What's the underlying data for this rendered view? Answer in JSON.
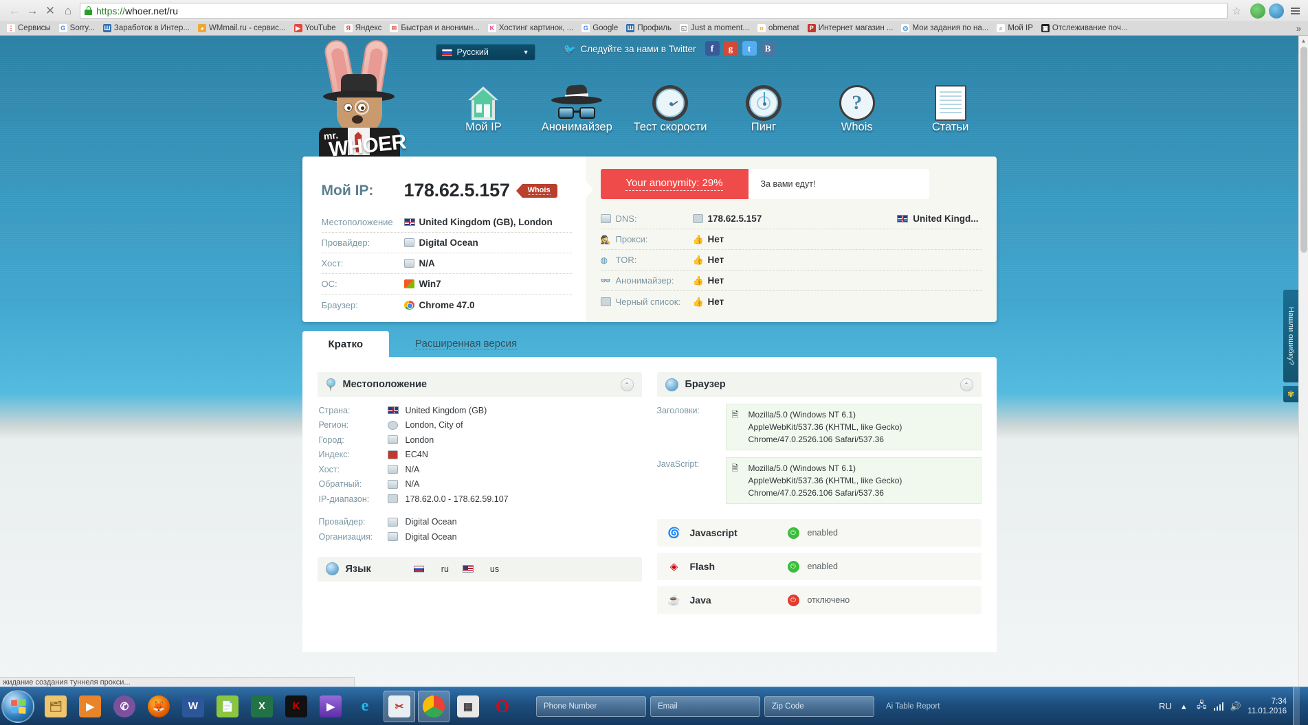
{
  "browser": {
    "back_icon": "back-arrow-icon",
    "forward_icon": "forward-arrow-icon",
    "stop_icon": "✕",
    "home_icon": "⌂",
    "url_scheme": "https://",
    "url_rest": "whoer.net/ru",
    "url_full": "https://whoer.net/ru",
    "star_icon": "☆",
    "bookmarks": [
      {
        "label": "Сервисы",
        "badge": "⋮",
        "color": "#e8453c"
      },
      {
        "label": "Sorry...",
        "badge": "G",
        "color": "#ffffff"
      },
      {
        "label": "Заработок в Интер...",
        "badge": "Ш",
        "color": "#2f6fb0"
      },
      {
        "label": "WMmail.ru - сервис...",
        "badge": "◕",
        "color": "#f0a830"
      },
      {
        "label": "YouTube",
        "badge": "▶",
        "color": "#e8453c"
      },
      {
        "label": "Яндекс",
        "badge": "Я",
        "color": "#e8453c"
      },
      {
        "label": "Быстрая и анонимн...",
        "badge": "✉",
        "color": "#d9534f"
      },
      {
        "label": "Хостинг картинок, ...",
        "badge": "K",
        "color": "#d93fa0"
      },
      {
        "label": "Google",
        "badge": "G",
        "color": "#4285f4"
      },
      {
        "label": "Профиль",
        "badge": "Ш",
        "color": "#2f6fb0"
      },
      {
        "label": "Just a moment...",
        "badge": "◱",
        "color": "#9aa0a6"
      },
      {
        "label": "obmenat",
        "badge": "о",
        "color": "#f0a830"
      },
      {
        "label": "Интернет магазин ...",
        "badge": "Р",
        "color": "#c0392b"
      },
      {
        "label": "Мои задания по на...",
        "badge": "◎",
        "color": "#4a90c2"
      },
      {
        "label": "Мой IP",
        "badge": "⌕",
        "color": "#9aa0a6"
      },
      {
        "label": "Отслеживание поч...",
        "badge": "▣",
        "color": "#222222"
      }
    ],
    "overflow_icon": "»"
  },
  "site": {
    "logo_mr": "mr.",
    "logo_name": "WHOER",
    "language": {
      "value": "Русский",
      "caret": "▼"
    },
    "twitter_text": "Следуйте за нами в Twitter",
    "social": [
      {
        "name": "facebook",
        "glyph": "f"
      },
      {
        "name": "google-plus",
        "glyph": "g"
      },
      {
        "name": "twitter",
        "glyph": "t"
      },
      {
        "name": "vk",
        "glyph": "B"
      }
    ],
    "nav": [
      {
        "label": "Мой IP",
        "icon": "home-icon"
      },
      {
        "label": "Анонимайзер",
        "icon": "hat-glasses-icon"
      },
      {
        "label": "Тест скорости",
        "icon": "speedometer-icon"
      },
      {
        "label": "Пинг",
        "icon": "radar-icon"
      },
      {
        "label": "Whois",
        "icon": "question-mark-icon"
      },
      {
        "label": "Статьи",
        "icon": "document-icon"
      }
    ]
  },
  "ipcard": {
    "ip_label": "Мой IP:",
    "ip_value": "178.62.5.157",
    "whois_button": "Whois",
    "left_rows": [
      {
        "label": "Местоположение",
        "value": "United Kingdom (GB), London",
        "icon": "flag-gb-icon"
      },
      {
        "label": "Провайдер:",
        "value": "Digital Ocean",
        "icon": "provider-icon"
      },
      {
        "label": "Хост:",
        "value": "N/A",
        "icon": "host-icon"
      },
      {
        "label": "ОС:",
        "value": "Win7",
        "icon": "windows-icon"
      },
      {
        "label": "Браузер:",
        "value": "Chrome 47.0",
        "icon": "chrome-icon"
      }
    ],
    "anonymity": {
      "text": "Your anonymity: 29%",
      "percent": 29,
      "note": "За вами едут!",
      "color": "#f04b4b"
    },
    "right_rows": [
      {
        "label": "DNS:",
        "value": "178.62.5.157",
        "extra": "United Kingd...",
        "icon": "dns-icon"
      },
      {
        "label": "Прокси:",
        "value": "Нет",
        "extra": "",
        "icon": "spy-icon"
      },
      {
        "label": "TOR:",
        "value": "Нет",
        "extra": "",
        "icon": "tor-icon"
      },
      {
        "label": "Анонимайзер:",
        "value": "Нет",
        "extra": "",
        "icon": "mask-icon"
      },
      {
        "label": "Черный список:",
        "value": "Нет",
        "extra": "",
        "icon": "list-icon"
      }
    ]
  },
  "tabs": [
    {
      "label": "Кратко",
      "active": true
    },
    {
      "label": "Расширенная версия",
      "active": false
    }
  ],
  "location_panel": {
    "title": "Местоположение",
    "collapse_icon": "⌃",
    "rows": [
      {
        "label": "Страна:",
        "value": "United Kingdom (GB)",
        "icon": "flag-gb-icon"
      },
      {
        "label": "Регион:",
        "value": "London, City of",
        "icon": "compass-icon"
      },
      {
        "label": "Город:",
        "value": "London",
        "icon": "city-icon"
      },
      {
        "label": "Индекс:",
        "value": "EC4N",
        "icon": "mailbox-icon"
      },
      {
        "label": "Хост:",
        "value": "N/A",
        "icon": "host-icon"
      },
      {
        "label": "Обратный:",
        "value": "N/A",
        "icon": "host-icon"
      },
      {
        "label": "IP-диапазон:",
        "value": "178.62.0.0 - 178.62.59.107",
        "icon": "range-icon"
      },
      {
        "label": "Провайдер:",
        "value": "Digital Ocean",
        "icon": "provider-icon"
      },
      {
        "label": "Организация:",
        "value": "Digital Ocean",
        "icon": "org-icon"
      }
    ],
    "language_title": "Язык",
    "languages": [
      {
        "code": "ru",
        "flag": "flag-ru-icon"
      },
      {
        "code": "us",
        "flag": "flag-us-icon"
      }
    ]
  },
  "browser_panel": {
    "title": "Браузер",
    "collapse_icon": "⌃",
    "headers_label": "Заголовки:",
    "headers_value_lines": [
      "Mozilla/5.0 (Windows NT 6.1)",
      "AppleWebKit/537.36 (KHTML, like Gecko)",
      "Chrome/47.0.2526.106 Safari/537.36"
    ],
    "javascript_label": "JavaScript:",
    "javascript_value_lines": [
      "Mozilla/5.0 (Windows NT 6.1)",
      "AppleWebKit/537.36 (KHTML, like Gecko)",
      "Chrome/47.0.2526.106 Safari/537.36"
    ],
    "features": [
      {
        "name": "Javascript",
        "status": "enabled",
        "state": "on",
        "icon": "js-icon"
      },
      {
        "name": "Flash",
        "status": "enabled",
        "state": "on",
        "icon": "flash-icon"
      },
      {
        "name": "Java",
        "status": "отключено",
        "state": "off",
        "icon": "java-icon"
      }
    ]
  },
  "feedback_tab": {
    "label": "Нашли ошибку?",
    "gear_icon": "✾"
  },
  "status_bar": {
    "text": "жидание создания туннеля прокси..."
  },
  "taskbar": {
    "start_icon": "windows-start-icon",
    "pinned": [
      {
        "name": "explorer-icon",
        "glyph": "🗂",
        "color": "#f0c36d"
      },
      {
        "name": "media-player-icon",
        "glyph": "▶",
        "color": "#e8852a"
      },
      {
        "name": "viber-icon",
        "glyph": "✆",
        "color": "#7b519d"
      },
      {
        "name": "firefox-icon",
        "glyph": "🦊",
        "color": "#e66000"
      },
      {
        "name": "word-icon",
        "glyph": "W",
        "color": "#2b579a"
      },
      {
        "name": "foxit-icon",
        "glyph": "📄",
        "color": "#8cc63e"
      },
      {
        "name": "excel-icon",
        "glyph": "X",
        "color": "#217346"
      },
      {
        "name": "kaspersky-icon",
        "glyph": "K",
        "color": "#cc0000"
      },
      {
        "name": "kmplayer-icon",
        "glyph": "▶",
        "color": "#6a3fa0"
      },
      {
        "name": "internet-explorer-icon",
        "glyph": "e",
        "color": "#1ebbee"
      },
      {
        "name": "snipping-tool-icon",
        "glyph": "✂",
        "color": "#c0392b"
      },
      {
        "name": "chrome-icon",
        "glyph": "◉",
        "color": "#4285f4"
      },
      {
        "name": "app-grid-icon",
        "glyph": "▦",
        "color": "#dddddd"
      },
      {
        "name": "opera-icon",
        "glyph": "O",
        "color": "#cc0f16"
      }
    ],
    "windows": [
      {
        "label": "Phone Number"
      },
      {
        "label": "Email"
      },
      {
        "label": "Zip Code"
      },
      {
        "label": "Ai Table Report"
      }
    ],
    "tray": {
      "language": "RU",
      "up_arrow": "▴",
      "network_icon": "network-error-icon",
      "signal_icon": "signal-bars-icon",
      "volume_icon": "🔊",
      "time": "7:34",
      "date": "11.01.2016"
    }
  }
}
